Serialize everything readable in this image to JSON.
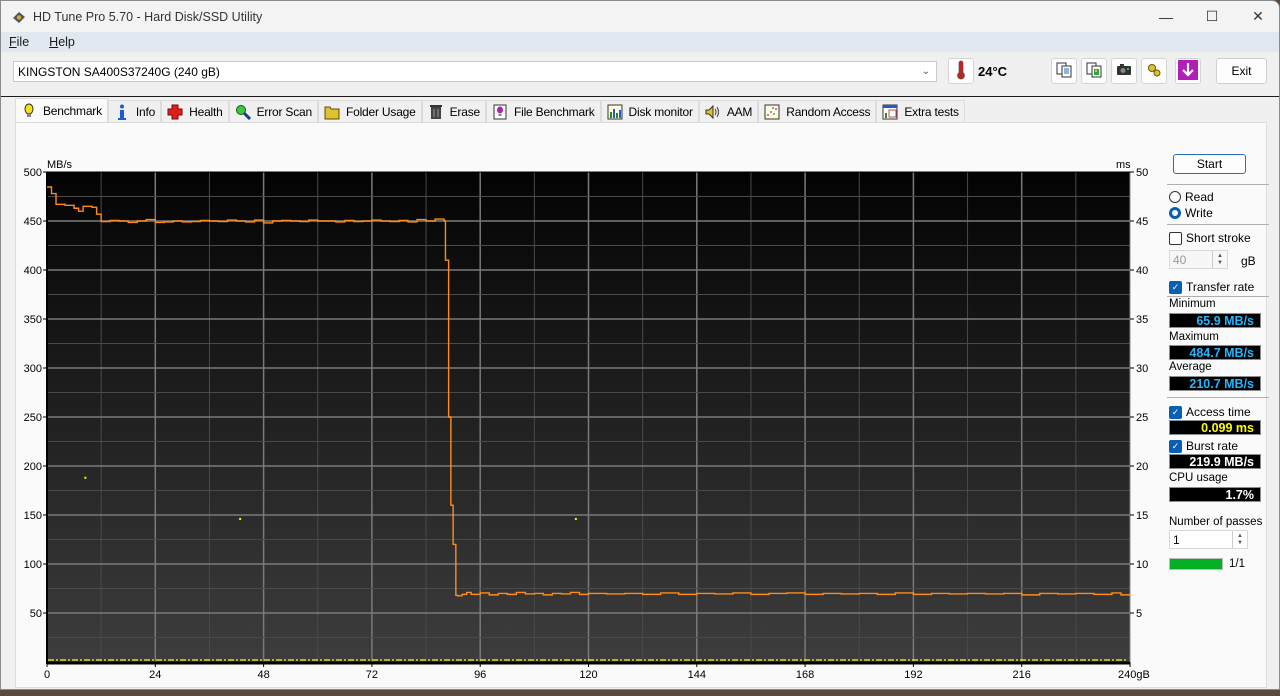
{
  "window": {
    "title": "HD Tune Pro 5.70 - Hard Disk/SSD Utility",
    "controls": {
      "minimize": "—",
      "maximize": "☐",
      "close": "✕"
    }
  },
  "menu": [
    {
      "label": "File",
      "accel": "F",
      "rest": "ile"
    },
    {
      "label": "Help",
      "accel": "H",
      "rest": "elp"
    }
  ],
  "toolbar": {
    "drive": "KINGSTON SA400S37240G (240 gB)",
    "temperature": "24°C",
    "icons": [
      "copy-text-icon",
      "copy-image-icon",
      "screenshot-icon",
      "options-icon",
      "save-icon"
    ],
    "exit_label": "Exit"
  },
  "tabs": [
    {
      "label": "Benchmark",
      "icon": "benchmark-icon",
      "active": true
    },
    {
      "label": "Info",
      "icon": "info-icon"
    },
    {
      "label": "Health",
      "icon": "health-icon"
    },
    {
      "label": "Error Scan",
      "icon": "error-scan-icon"
    },
    {
      "label": "Folder Usage",
      "icon": "folder-usage-icon"
    },
    {
      "label": "Erase",
      "icon": "erase-icon"
    },
    {
      "label": "File Benchmark",
      "icon": "file-benchmark-icon"
    },
    {
      "label": "Disk monitor",
      "icon": "disk-monitor-icon"
    },
    {
      "label": "AAM",
      "icon": "aam-icon"
    },
    {
      "label": "Random Access",
      "icon": "random-access-icon"
    },
    {
      "label": "Extra tests",
      "icon": "extra-tests-icon"
    }
  ],
  "side": {
    "start_label": "Start",
    "mode": {
      "read_label": "Read",
      "write_label": "Write",
      "selected": "Write"
    },
    "short_stroke": {
      "label": "Short stroke",
      "checked": false,
      "value": "40",
      "unit": "gB"
    },
    "transfer_rate": {
      "label": "Transfer rate",
      "checked": true
    },
    "minimum": {
      "label": "Minimum",
      "value": "65.9 MB/s"
    },
    "maximum": {
      "label": "Maximum",
      "value": "484.7 MB/s"
    },
    "average": {
      "label": "Average",
      "value": "210.7 MB/s"
    },
    "access_time": {
      "label": "Access time",
      "checked": true,
      "value": "0.099 ms"
    },
    "burst_rate": {
      "label": "Burst rate",
      "checked": true,
      "value": "219.9 MB/s"
    },
    "cpu_usage": {
      "label": "CPU usage",
      "value": "1.7%"
    },
    "passes": {
      "label": "Number of passes",
      "value": "1",
      "progress_text": "1/1",
      "progress": 1.0
    },
    "colors": {
      "rate": "#1fb6ff",
      "access": "#ffff00",
      "white": "#ffffff"
    }
  },
  "chart_data": {
    "type": "line",
    "title": "",
    "xlabel": "gB",
    "ylabel": "MB/s",
    "y2label": "ms",
    "xlim": [
      0,
      240
    ],
    "ylim": [
      0,
      500
    ],
    "y2lim": [
      0,
      50
    ],
    "grid": true,
    "x_ticks": [
      0,
      24,
      48,
      72,
      96,
      120,
      144,
      168,
      192,
      216,
      240
    ],
    "x_tick_labels": [
      "0",
      "24",
      "48",
      "72",
      "96",
      "120",
      "144",
      "168",
      "192",
      "216",
      "240gB"
    ],
    "y_ticks": [
      50,
      100,
      150,
      200,
      250,
      300,
      350,
      400,
      450,
      500
    ],
    "y2_ticks": [
      5,
      10,
      15,
      20,
      25,
      30,
      35,
      40,
      45,
      50
    ],
    "series": [
      {
        "name": "Transfer rate (MB/s)",
        "color": "#ff8c1a",
        "x": [
          0,
          1,
          2,
          4,
          6,
          7,
          8,
          10,
          11,
          12,
          14,
          16,
          18,
          20,
          22,
          24,
          26,
          28,
          30,
          32,
          34,
          36,
          38,
          40,
          42,
          44,
          46,
          48,
          50,
          52,
          54,
          56,
          58,
          60,
          62,
          64,
          66,
          68,
          70,
          72,
          74,
          76,
          78,
          80,
          82,
          84,
          86,
          88,
          88.3,
          89,
          89.5,
          90,
          90.6,
          91,
          92,
          93,
          94,
          96,
          98,
          100,
          102,
          104,
          106,
          108,
          110,
          112,
          114,
          116,
          118,
          120,
          124,
          128,
          132,
          136,
          140,
          144,
          148,
          152,
          156,
          160,
          164,
          168,
          172,
          176,
          180,
          184,
          188,
          192,
          196,
          200,
          204,
          208,
          212,
          216,
          220,
          224,
          228,
          232,
          236,
          238,
          240
        ],
        "values": [
          484.7,
          478,
          467,
          466,
          463,
          460,
          465,
          464,
          457,
          449.5,
          450.5,
          450,
          448.5,
          450,
          451.5,
          448.5,
          449,
          450,
          449,
          449.5,
          450.5,
          450,
          449.5,
          451,
          450,
          449,
          451,
          448,
          450,
          450.5,
          450,
          449.5,
          451,
          450,
          450,
          449,
          450.5,
          449.5,
          450,
          451,
          450,
          449.5,
          450.5,
          449,
          451.5,
          450,
          452,
          450,
          410,
          250,
          160,
          120,
          68,
          67.5,
          69,
          71,
          69,
          70.5,
          68.5,
          70,
          69,
          71,
          69.5,
          70,
          68.5,
          70,
          69.5,
          71,
          69,
          70,
          69.5,
          70,
          69,
          70.5,
          69,
          70,
          69.5,
          70.5,
          69,
          70,
          70.5,
          69,
          70,
          69.5,
          70,
          69,
          70.5,
          69,
          70,
          69.5,
          70,
          69.5,
          70,
          68.5,
          70,
          69.5,
          70,
          69,
          70.5,
          68.5,
          70
        ]
      },
      {
        "name": "Access time (ms)",
        "color": "#ffff00",
        "axis": "y2",
        "points": [
          [
            8.5,
            18.8
          ],
          [
            42.8,
            14.6
          ],
          [
            117.2,
            14.6
          ]
        ],
        "baseline": 0.099
      }
    ]
  }
}
